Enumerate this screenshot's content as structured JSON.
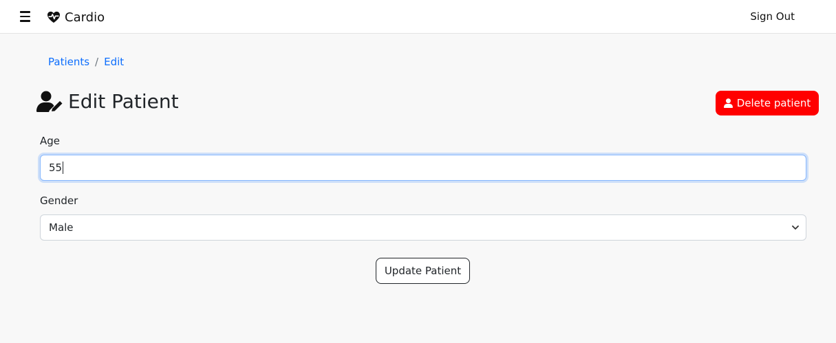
{
  "nav": {
    "brand": "Cardio",
    "sign_out": "Sign Out",
    "icons": {
      "menu": "hamburger-icon",
      "brand": "heart-pulse-icon"
    }
  },
  "breadcrumb": {
    "items": [
      "Patients",
      "Edit"
    ],
    "separator": "/"
  },
  "page": {
    "title": "Edit Patient",
    "title_icon": "user-edit-icon",
    "delete_button": "Delete patient",
    "delete_icon": "user-icon"
  },
  "form": {
    "age_label": "Age",
    "age_value": "55",
    "gender_label": "Gender",
    "gender_value": "Male",
    "submit": "Update Patient"
  },
  "colors": {
    "accent": "#0d6efd",
    "danger": "#ff0000",
    "focus_border": "#86b7fe"
  }
}
